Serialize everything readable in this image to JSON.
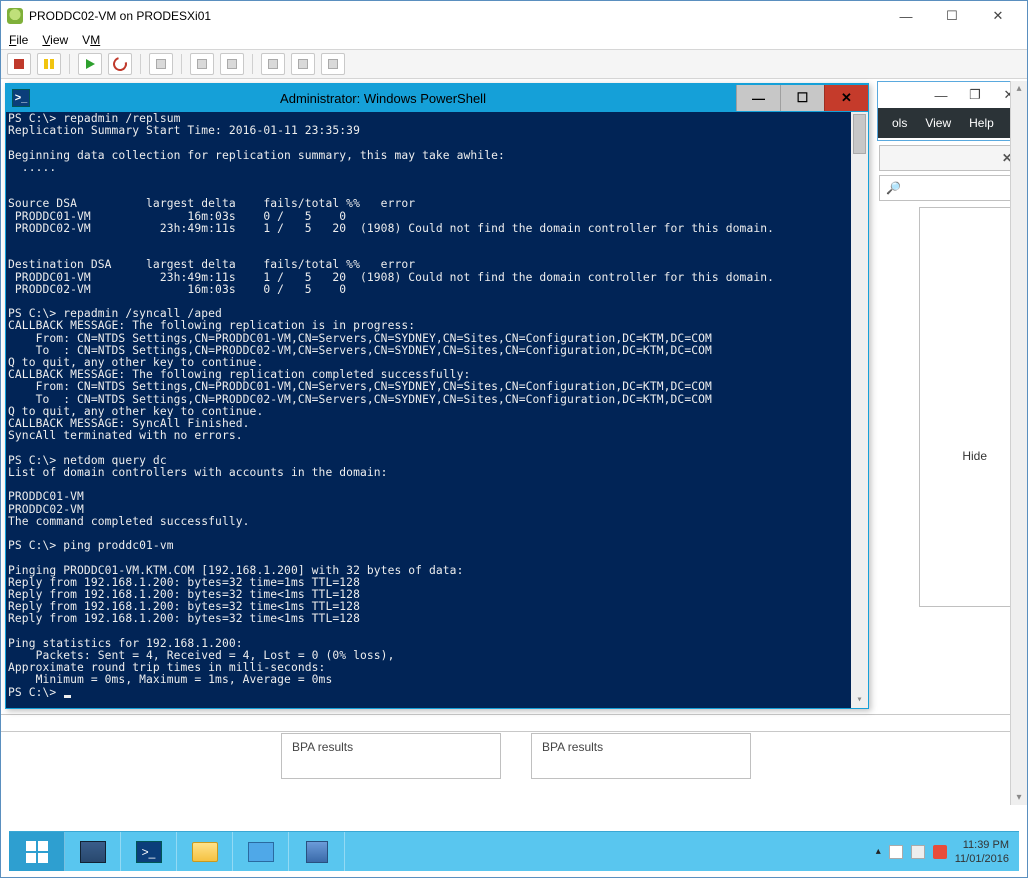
{
  "vsphere": {
    "title": "PRODDC02-VM on PRODESXi01",
    "menu": {
      "file": "File",
      "view": "View",
      "vm": "VM"
    }
  },
  "server_manager": {
    "menu": {
      "tools": "ols",
      "view": "View",
      "help": "Help"
    },
    "hide": "Hide",
    "bpa": "BPA results",
    "search_placeholder": "🔎"
  },
  "powershell": {
    "title": "Administrator: Windows PowerShell",
    "content": "PS C:\\> repadmin /replsum\nReplication Summary Start Time: 2016-01-11 23:35:39\n\nBeginning data collection for replication summary, this may take awhile:\n  .....\n\n\nSource DSA          largest delta    fails/total %%   error\n PRODDC01-VM              16m:03s    0 /   5    0\n PRODDC02-VM          23h:49m:11s    1 /   5   20  (1908) Could not find the domain controller for this domain.\n\n\nDestination DSA     largest delta    fails/total %%   error\n PRODDC01-VM          23h:49m:11s    1 /   5   20  (1908) Could not find the domain controller for this domain.\n PRODDC02-VM              16m:03s    0 /   5    0\n\nPS C:\\> repadmin /syncall /aped\nCALLBACK MESSAGE: The following replication is in progress:\n    From: CN=NTDS Settings,CN=PRODDC01-VM,CN=Servers,CN=SYDNEY,CN=Sites,CN=Configuration,DC=KTM,DC=COM\n    To  : CN=NTDS Settings,CN=PRODDC02-VM,CN=Servers,CN=SYDNEY,CN=Sites,CN=Configuration,DC=KTM,DC=COM\nQ to quit, any other key to continue.\nCALLBACK MESSAGE: The following replication completed successfully:\n    From: CN=NTDS Settings,CN=PRODDC01-VM,CN=Servers,CN=SYDNEY,CN=Sites,CN=Configuration,DC=KTM,DC=COM\n    To  : CN=NTDS Settings,CN=PRODDC02-VM,CN=Servers,CN=SYDNEY,CN=Sites,CN=Configuration,DC=KTM,DC=COM\nQ to quit, any other key to continue.\nCALLBACK MESSAGE: SyncAll Finished.\nSyncAll terminated with no errors.\n\nPS C:\\> netdom query dc\nList of domain controllers with accounts in the domain:\n\nPRODDC01-VM\nPRODDC02-VM\nThe command completed successfully.\n\nPS C:\\> ping proddc01-vm\n\nPinging PRODDC01-VM.KTM.COM [192.168.1.200] with 32 bytes of data:\nReply from 192.168.1.200: bytes=32 time=1ms TTL=128\nReply from 192.168.1.200: bytes=32 time<1ms TTL=128\nReply from 192.168.1.200: bytes=32 time<1ms TTL=128\nReply from 192.168.1.200: bytes=32 time<1ms TTL=128\n\nPing statistics for 192.168.1.200:\n    Packets: Sent = 4, Received = 4, Lost = 0 (0% loss),\nApproximate round trip times in milli-seconds:\n    Minimum = 0ms, Maximum = 1ms, Average = 0ms\nPS C:\\> "
  },
  "taskbar": {
    "time": "11:39 PM",
    "date": "11/01/2016"
  }
}
